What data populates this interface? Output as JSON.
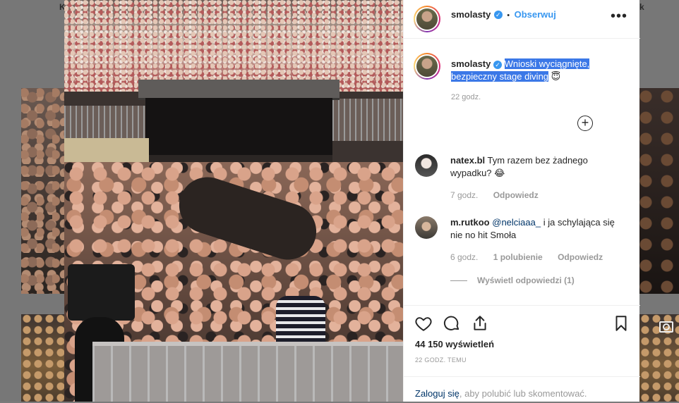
{
  "background": {
    "top_letters": [
      "K",
      "k"
    ]
  },
  "post": {
    "username": "smolasty",
    "verified_icon": "verified-badge-icon",
    "follow_separator": "•",
    "follow_label": "Obserwuj",
    "more_icon": "more-options-icon",
    "more_label": "•••",
    "caption": {
      "username": "smolasty",
      "text": "Wnioski wyciągnięte, bezpieczny stage diving",
      "emoji": "😇",
      "time": "22 godz."
    },
    "load_more_label": "+",
    "comments": [
      {
        "username": "natex.bl",
        "text": "Tym razem bez żadnego wypadku?",
        "emoji": "😂",
        "time": "7 godz.",
        "reply_label": "Odpowiedz"
      },
      {
        "username": "m.rutkoo",
        "mention": "@nelciaaa_",
        "text": " i ja schylająca się nie no hit Smoła",
        "time": "6 godz.",
        "likes": "1 polubienie",
        "reply_label": "Odpowiedz"
      }
    ],
    "view_replies": "Wyświetl odpowiedzi (1)",
    "views": "44 150 wyświetleń",
    "post_time": "22 GODZ. TEMU",
    "login_link": "Zaloguj się",
    "login_rest": ", aby polubić lub skomentować."
  },
  "colors": {
    "accent": "#3897f0",
    "link": "#003569",
    "muted": "#999999",
    "text": "#262626",
    "highlight": "#3b78e7"
  }
}
